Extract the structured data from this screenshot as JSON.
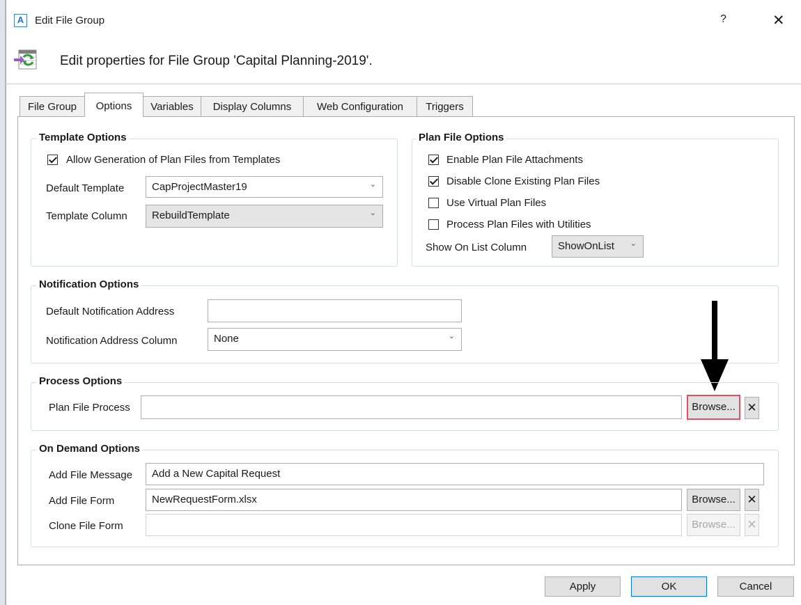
{
  "window": {
    "app_icon_letter": "A",
    "title": "Edit File Group",
    "help_label": "?",
    "close_label": "✕"
  },
  "header": {
    "icon": "file-group-refresh-icon",
    "description": "Edit properties for File Group 'Capital Planning-2019'."
  },
  "tabs": [
    {
      "label": "File Group",
      "active": false
    },
    {
      "label": "Options",
      "active": true
    },
    {
      "label": "Variables",
      "active": false
    },
    {
      "label": "Display Columns",
      "active": false
    },
    {
      "label": "Web Configuration",
      "active": false
    },
    {
      "label": "Triggers",
      "active": false
    }
  ],
  "template_options": {
    "title": "Template Options",
    "allow_generation": {
      "label": "Allow Generation of Plan Files from Templates",
      "checked": true
    },
    "default_template": {
      "label": "Default Template",
      "value": "CapProjectMaster19"
    },
    "template_column": {
      "label": "Template Column",
      "value": "RebuildTemplate"
    }
  },
  "plan_file_options": {
    "title": "Plan File Options",
    "checkboxes": [
      {
        "label": "Enable Plan File Attachments",
        "checked": true
      },
      {
        "label": "Disable Clone Existing Plan Files",
        "checked": true
      },
      {
        "label": "Use Virtual Plan Files",
        "checked": false
      },
      {
        "label": "Process Plan Files with Utilities",
        "checked": false
      }
    ],
    "show_on_list": {
      "label": "Show On List Column",
      "value": "ShowOnList"
    }
  },
  "notification_options": {
    "title": "Notification Options",
    "default_address": {
      "label": "Default Notification Address",
      "value": ""
    },
    "address_column": {
      "label": "Notification Address Column",
      "value": "None"
    }
  },
  "process_options": {
    "title": "Process Options",
    "plan_file_process": {
      "label": "Plan File Process",
      "value": "",
      "browse_label": "Browse...",
      "clear_label": "✕"
    }
  },
  "on_demand_options": {
    "title": "On Demand Options",
    "add_file_message": {
      "label": "Add File Message",
      "value": "Add a New Capital Request"
    },
    "add_file_form": {
      "label": "Add File Form",
      "value": "NewRequestForm.xlsx",
      "browse_label": "Browse...",
      "clear_label": "✕"
    },
    "clone_file_form": {
      "label": "Clone File Form",
      "value": "",
      "browse_label": "Browse...",
      "clear_label": "✕"
    }
  },
  "footer": {
    "apply_label": "Apply",
    "ok_label": "OK",
    "cancel_label": "Cancel"
  },
  "colors": {
    "highlight": "#e15060",
    "annotation_arrow": "#000000",
    "primary_button_border": "#0078d7"
  }
}
